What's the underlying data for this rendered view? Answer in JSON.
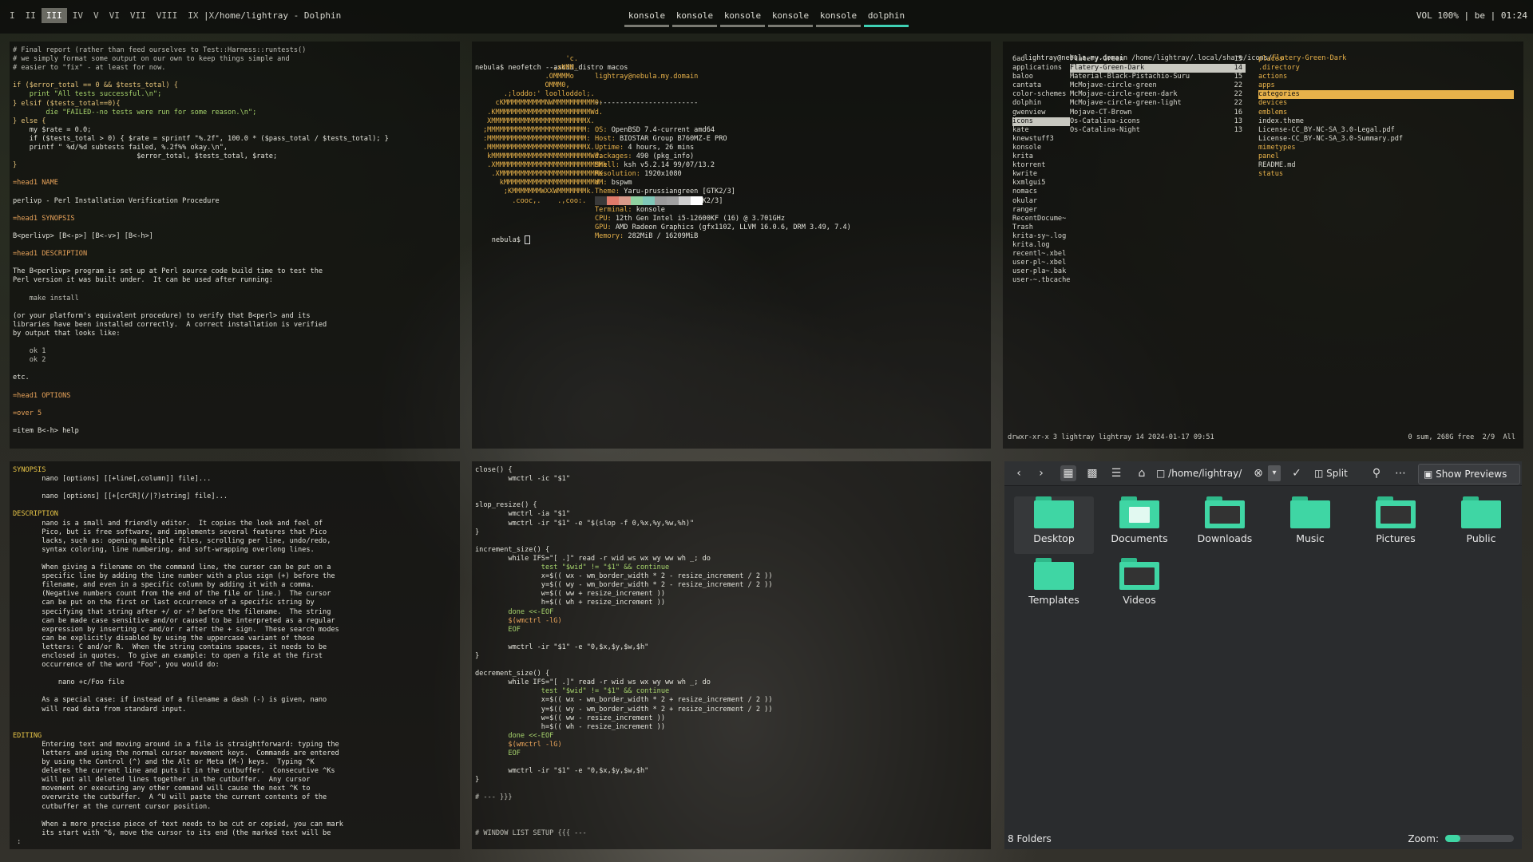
{
  "topbar": {
    "workspaces": [
      {
        "label": "I",
        "active": false
      },
      {
        "label": "II",
        "active": false
      },
      {
        "label": "III",
        "active": true
      },
      {
        "label": "IV",
        "active": false
      },
      {
        "label": "V",
        "active": false
      },
      {
        "label": "VI",
        "active": false
      },
      {
        "label": "VII",
        "active": false
      },
      {
        "label": "VIII",
        "active": false
      },
      {
        "label": "IX",
        "active": false
      },
      {
        "label": "X",
        "active": false
      }
    ],
    "title": "| /home/lightray - Dolphin",
    "tabs": [
      {
        "label": "konsole",
        "active": false
      },
      {
        "label": "konsole",
        "active": false
      },
      {
        "label": "konsole",
        "active": false
      },
      {
        "label": "konsole",
        "active": false
      },
      {
        "label": "konsole",
        "active": false
      },
      {
        "label": "dolphin",
        "active": true
      }
    ],
    "status": "VOL 100% | be | 01:24",
    "accent": "#3fd1b4"
  },
  "pane_perl": {
    "lines": [
      {
        "t": "# Final report (rather than feed ourselves to Test::Harness::runtests()",
        "c": "cm"
      },
      {
        "t": "# we simply format some output on our own to keep things simple and",
        "c": "cm"
      },
      {
        "t": "# easier to \"fix\" - at least for now.",
        "c": "cm"
      },
      {
        "t": "",
        "c": ""
      },
      {
        "t": "if ($error_total == 0 && $tests_total) {",
        "c": "kw"
      },
      {
        "t": "    print \"All tests successful.\\n\";",
        "c": "gr"
      },
      {
        "t": "} elsif ($tests_total==0){",
        "c": "kw"
      },
      {
        "t": "        die \"FAILED--no tests were run for some reason.\\n\";",
        "c": "gr"
      },
      {
        "t": "} else {",
        "c": "kw"
      },
      {
        "t": "    my $rate = 0.0;",
        "c": "mg"
      },
      {
        "t": "    if ($tests_total > 0) { $rate = sprintf \"%.2f\", 100.0 * ($pass_total / $tests_total); }",
        "c": "mg"
      },
      {
        "t": "    printf \" %d/%d subtests failed, %.2f%% okay.\\n\",",
        "c": "mg"
      },
      {
        "t": "                              $error_total, $tests_total, $rate;",
        "c": "mg"
      },
      {
        "t": "}",
        "c": "kw"
      },
      {
        "t": "",
        "c": ""
      },
      {
        "t": "=head1 NAME",
        "c": "hd"
      },
      {
        "t": "",
        "c": ""
      },
      {
        "t": "perlivp - Perl Installation Verification Procedure",
        "c": "mg"
      },
      {
        "t": "",
        "c": ""
      },
      {
        "t": "=head1 SYNOPSIS",
        "c": "hd"
      },
      {
        "t": "",
        "c": ""
      },
      {
        "t": "B<perlivp> [B<-p>] [B<-v>] [B<-h>]",
        "c": "mg"
      },
      {
        "t": "",
        "c": ""
      },
      {
        "t": "=head1 DESCRIPTION",
        "c": "hd"
      },
      {
        "t": "",
        "c": ""
      },
      {
        "t": "The B<perlivp> program is set up at Perl source code build time to test the",
        "c": "mg"
      },
      {
        "t": "Perl version it was built under.  It can be used after running:",
        "c": "mg"
      },
      {
        "t": "",
        "c": ""
      },
      {
        "t": "    make install",
        "c": "cm"
      },
      {
        "t": "",
        "c": ""
      },
      {
        "t": "(or your platform's equivalent procedure) to verify that B<perl> and its",
        "c": "mg"
      },
      {
        "t": "libraries have been installed correctly.  A correct installation is verified",
        "c": "mg"
      },
      {
        "t": "by output that looks like:",
        "c": "mg"
      },
      {
        "t": "",
        "c": ""
      },
      {
        "t": "    ok 1",
        "c": "cm"
      },
      {
        "t": "    ok 2",
        "c": "cm"
      },
      {
        "t": "",
        "c": ""
      },
      {
        "t": "etc.",
        "c": "mg"
      },
      {
        "t": "",
        "c": ""
      },
      {
        "t": "=head1 OPTIONS",
        "c": "hd"
      },
      {
        "t": "",
        "c": ""
      },
      {
        "t": "=over 5",
        "c": "hd"
      },
      {
        "t": "",
        "c": ""
      },
      {
        "t": "=item B<-h> help",
        "c": "mg"
      }
    ]
  },
  "pane_neofetch": {
    "prompt": "nebula$ neofetch --ascii_distro macos",
    "art": [
      "                    'c.",
      "                 ,xNMM.",
      "               .OMMMMo",
      "               OMMM0,",
      "     .;loddo:' loolloddol;.",
      "   cKMMMMMMMMMMNWMMMMMMMMMM0:",
      " .KMMMMMMMMMMMMMMMMMMMMMMMWd.",
      " XMMMMMMMMMMMMMMMMMMMMMMMX.",
      ";MMMMMMMMMMMMMMMMMMMMMMMM:",
      ":MMMMMMMMMMMMMMMMMMMMMMMM:",
      ".MMMMMMMMMMMMMMMMMMMMMMMMX.",
      " kMMMMMMMMMMMMMMMMMMMMMMMMWd.",
      " .XMMMMMMMMMMMMMMMMMMMMMMMMMMk",
      "  .XMMMMMMMMMMMMMMMMMMMMMMMMK.",
      "    kMMMMMMMMMMMMMMMMMMMMMMd",
      "     ;KMMMMMMMWXXWMMMMMMMk.",
      "       .cooc,.    .,coo:."
    ],
    "user_host": "lightray@nebula.my.domain",
    "separator": "-------------------------",
    "info": [
      {
        "k": "OS:",
        "v": " OpenBSD 7.4-current amd64"
      },
      {
        "k": "Host:",
        "v": " BIOSTAR Group B760MZ-E PRO"
      },
      {
        "k": "Uptime:",
        "v": " 4 hours, 26 mins"
      },
      {
        "k": "Packages:",
        "v": " 490 (pkg_info)"
      },
      {
        "k": "Shell:",
        "v": " ksh v5.2.14 99/07/13.2"
      },
      {
        "k": "Resolution:",
        "v": " 1920x1080"
      },
      {
        "k": "WM:",
        "v": " bspwm"
      },
      {
        "k": "Theme:",
        "v": " Yaru-prussiangreen [GTK2/3]"
      },
      {
        "k": "Icons:",
        "v": " Mojave-CT-Brown [GTK2/3]"
      },
      {
        "k": "Terminal:",
        "v": " konsole"
      },
      {
        "k": "CPU:",
        "v": " 12th Gen Intel i5-12600KF (16) @ 3.701GHz"
      },
      {
        "k": "GPU:",
        "v": " AMD Radeon Graphics (gfx1102, LLVM 16.0.6, DRM 3.49, 7.4)"
      },
      {
        "k": "Memory:",
        "v": " 282MiB / 16209MiB"
      }
    ],
    "colors": [
      "#3a3a3a",
      "#e07a6a",
      "#d89a8a",
      "#8fd1a0",
      "#7fc7b8",
      "#9a9a9a",
      "#a0a0a0",
      "#cfcfcf",
      "#ffffff"
    ],
    "prompt2": "nebula$ "
  },
  "pane_ranger": {
    "path_user": "lightray@nebula.my.domain",
    "path_dir": " /home/lightray/.local/share/icons/",
    "path_sel": "Flatery-Green-Dark",
    "col1": [
      "6ad",
      "applications",
      "baloo",
      "cantata",
      "color-schemes",
      "dolphin",
      "gwenview",
      "icons",
      "kate",
      "knewstuff3",
      "konsole",
      "krita",
      "ktorrent",
      "kwrite",
      "kxmlgui5",
      "nomacs",
      "okular",
      "ranger",
      "RecentDocume~",
      "Trash",
      "krita-sy~.log",
      "krita.log",
      "recentl~.xbel",
      "user-pl~.xbel",
      "user-pla~.bak",
      "user-~.tbcache"
    ],
    "col2": [
      {
        "n": "Flatery-Green",
        "c": "15"
      },
      {
        "n": "Flatery-Green-Dark",
        "c": "14"
      },
      {
        "n": "Material-Black-Pistachio-Suru",
        "c": "15"
      },
      {
        "n": "McMojave-circle-green",
        "c": "22"
      },
      {
        "n": "McMojave-circle-green-dark",
        "c": "22"
      },
      {
        "n": "McMojave-circle-green-light",
        "c": "22"
      },
      {
        "n": "Mojave-CT-Brown",
        "c": "16"
      },
      {
        "n": "Os-Catalina-icons",
        "c": "13"
      },
      {
        "n": "Os-Catalina-Night",
        "c": "13"
      }
    ],
    "col3": [
      "places",
      ".directory",
      "actions",
      "apps",
      "categories",
      "devices",
      "emblems",
      "index.theme",
      "License-CC_BY-NC-SA_3.0-Legal.pdf",
      "License-CC_BY-NC-SA_3.0-Summary.pdf",
      "mimetypes",
      "panel",
      "README.md",
      "status"
    ],
    "footer_left": "drwxr-xr-x 3 lightray lightray 14 2024-01-17 09:51",
    "footer_right": "0 sum, 268G free  2/9  All"
  },
  "pane_nano": {
    "lines": [
      {
        "t": "SYNOPSIS",
        "c": "bl"
      },
      {
        "t": "       nano [options] [[+line[,column]] file]...",
        "c": "mg"
      },
      {
        "t": "",
        "c": ""
      },
      {
        "t": "       nano [options] [[+[crCR](/|?)string] file]...",
        "c": "mg"
      },
      {
        "t": "",
        "c": ""
      },
      {
        "t": "DESCRIPTION",
        "c": "bl"
      },
      {
        "t": "       nano is a small and friendly editor.  It copies the look and feel of",
        "c": "mg"
      },
      {
        "t": "       Pico, but is free software, and implements several features that Pico",
        "c": "mg"
      },
      {
        "t": "       lacks, such as: opening multiple files, scrolling per line, undo/redo,",
        "c": "mg"
      },
      {
        "t": "       syntax coloring, line numbering, and soft-wrapping overlong lines.",
        "c": "mg"
      },
      {
        "t": "",
        "c": ""
      },
      {
        "t": "       When giving a filename on the command line, the cursor can be put on a",
        "c": "mg"
      },
      {
        "t": "       specific line by adding the line number with a plus sign (+) before the",
        "c": "mg"
      },
      {
        "t": "       filename, and even in a specific column by adding it with a comma.",
        "c": "mg"
      },
      {
        "t": "       (Negative numbers count from the end of the file or line.)  The cursor",
        "c": "mg"
      },
      {
        "t": "       can be put on the first or last occurrence of a specific string by",
        "c": "mg"
      },
      {
        "t": "       specifying that string after +/ or +? before the filename.  The string",
        "c": "mg"
      },
      {
        "t": "       can be made case sensitive and/or caused to be interpreted as a regular",
        "c": "mg"
      },
      {
        "t": "       expression by inserting c and/or r after the + sign.  These search modes",
        "c": "mg"
      },
      {
        "t": "       can be explicitly disabled by using the uppercase variant of those",
        "c": "mg"
      },
      {
        "t": "       letters: C and/or R.  When the string contains spaces, it needs to be",
        "c": "mg"
      },
      {
        "t": "       enclosed in quotes.  To give an example: to open a file at the first",
        "c": "mg"
      },
      {
        "t": "       occurrence of the word \"Foo\", you would do:",
        "c": "mg"
      },
      {
        "t": "",
        "c": ""
      },
      {
        "t": "           nano +c/Foo file",
        "c": "mg"
      },
      {
        "t": "",
        "c": ""
      },
      {
        "t": "       As a special case: if instead of a filename a dash (-) is given, nano",
        "c": "mg"
      },
      {
        "t": "       will read data from standard input.",
        "c": "mg"
      },
      {
        "t": "",
        "c": ""
      },
      {
        "t": "",
        "c": ""
      },
      {
        "t": "EDITING",
        "c": "bl"
      },
      {
        "t": "       Entering text and moving around in a file is straightforward: typing the",
        "c": "mg"
      },
      {
        "t": "       letters and using the normal cursor movement keys.  Commands are entered",
        "c": "mg"
      },
      {
        "t": "       by using the Control (^) and the Alt or Meta (M-) keys.  Typing ^K",
        "c": "mg"
      },
      {
        "t": "       deletes the current line and puts it in the cutbuffer.  Consecutive ^Ks",
        "c": "mg"
      },
      {
        "t": "       will put all deleted lines together in the cutbuffer.  Any cursor",
        "c": "mg"
      },
      {
        "t": "       movement or executing any other command will cause the next ^K to",
        "c": "mg"
      },
      {
        "t": "       overwrite the cutbuffer.  A ^U will paste the current contents of the",
        "c": "mg"
      },
      {
        "t": "       cutbuffer at the current cursor position.",
        "c": "mg"
      },
      {
        "t": "",
        "c": ""
      },
      {
        "t": "       When a more precise piece of text needs to be cut or copied, you can mark",
        "c": "mg"
      },
      {
        "t": "       its start with ^6, move the cursor to its end (the marked text will be",
        "c": "mg"
      },
      {
        "t": " :",
        "c": "mg"
      }
    ]
  },
  "pane_shell": {
    "lines": [
      {
        "t": "close() {",
        "c": "mg"
      },
      {
        "t": "        wmctrl -ic \"$1\"",
        "c": "mg"
      },
      {
        "t": "",
        "c": ""
      },
      {
        "t": "",
        "c": ""
      },
      {
        "t": "slop_resize() {",
        "c": "mg"
      },
      {
        "t": "        wmctrl -ia \"$1\"",
        "c": "mg"
      },
      {
        "t": "        wmctrl -ir \"$1\" -e \"$(slop -f 0,%x,%y,%w,%h)\"",
        "c": "mg"
      },
      {
        "t": "}",
        "c": "mg"
      },
      {
        "t": "",
        "c": ""
      },
      {
        "t": "increment_size() {",
        "c": "mg"
      },
      {
        "t": "        while IFS=\"[ .]\" read -r wid ws wx wy ww wh _; do",
        "c": "mg"
      },
      {
        "t": "                test \"$wid\" != \"$1\" && continue",
        "c": "gr"
      },
      {
        "t": "                x=$(( wx - wm_border_width * 2 - resize_increment / 2 ))",
        "c": "mg"
      },
      {
        "t": "                y=$(( wy - wm_border_width * 2 - resize_increment / 2 ))",
        "c": "mg"
      },
      {
        "t": "                w=$(( ww + resize_increment ))",
        "c": "mg"
      },
      {
        "t": "                h=$(( wh + resize_increment ))",
        "c": "mg"
      },
      {
        "t": "        done <<-EOF",
        "c": "gr"
      },
      {
        "t": "        $(wmctrl -lG)",
        "c": "hd"
      },
      {
        "t": "        EOF",
        "c": "gr"
      },
      {
        "t": "",
        "c": ""
      },
      {
        "t": "        wmctrl -ir \"$1\" -e \"0,$x,$y,$w,$h\"",
        "c": "mg"
      },
      {
        "t": "}",
        "c": "mg"
      },
      {
        "t": "",
        "c": ""
      },
      {
        "t": "decrement_size() {",
        "c": "mg"
      },
      {
        "t": "        while IFS=\"[ .]\" read -r wid ws wx wy ww wh _; do",
        "c": "mg"
      },
      {
        "t": "                test \"$wid\" != \"$1\" && continue",
        "c": "gr"
      },
      {
        "t": "                x=$(( wx - wm_border_width * 2 + resize_increment / 2 ))",
        "c": "mg"
      },
      {
        "t": "                y=$(( wy - wm_border_width * 2 + resize_increment / 2 ))",
        "c": "mg"
      },
      {
        "t": "                w=$(( ww - resize_increment ))",
        "c": "mg"
      },
      {
        "t": "                h=$(( wh - resize_increment ))",
        "c": "mg"
      },
      {
        "t": "        done <<-EOF",
        "c": "gr"
      },
      {
        "t": "        $(wmctrl -lG)",
        "c": "hd"
      },
      {
        "t": "        EOF",
        "c": "gr"
      },
      {
        "t": "",
        "c": ""
      },
      {
        "t": "        wmctrl -ir \"$1\" -e \"0,$x,$y,$w,$h\"",
        "c": "mg"
      },
      {
        "t": "}",
        "c": "mg"
      },
      {
        "t": "",
        "c": ""
      },
      {
        "t": "# --- }}}",
        "c": "cm"
      },
      {
        "t": "",
        "c": ""
      },
      {
        "t": "",
        "c": ""
      },
      {
        "t": "",
        "c": ""
      },
      {
        "t": "# WINDOW LIST SETUP {{{ ---",
        "c": "cm"
      }
    ]
  },
  "dolphin": {
    "address": "/home/lightray/",
    "split_label": "Split",
    "previews_label": "Show Previews",
    "folders": [
      {
        "label": "Desktop",
        "icon": "folder-desktop-icon",
        "selected": true
      },
      {
        "label": "Documents",
        "icon": "folder-documents-icon",
        "selected": false
      },
      {
        "label": "Downloads",
        "icon": "folder-downloads-icon",
        "selected": false
      },
      {
        "label": "Music",
        "icon": "folder-music-icon",
        "selected": false
      },
      {
        "label": "Pictures",
        "icon": "folder-pictures-icon",
        "selected": false
      },
      {
        "label": "Public",
        "icon": "folder-public-icon",
        "selected": false
      },
      {
        "label": "Templates",
        "icon": "folder-templates-icon",
        "selected": false
      },
      {
        "label": "Videos",
        "icon": "folder-videos-icon",
        "selected": false
      }
    ],
    "status": "8 Folders",
    "zoom_label": "Zoom:",
    "zoom_level": 0.22,
    "accent": "#3fd6a4"
  }
}
